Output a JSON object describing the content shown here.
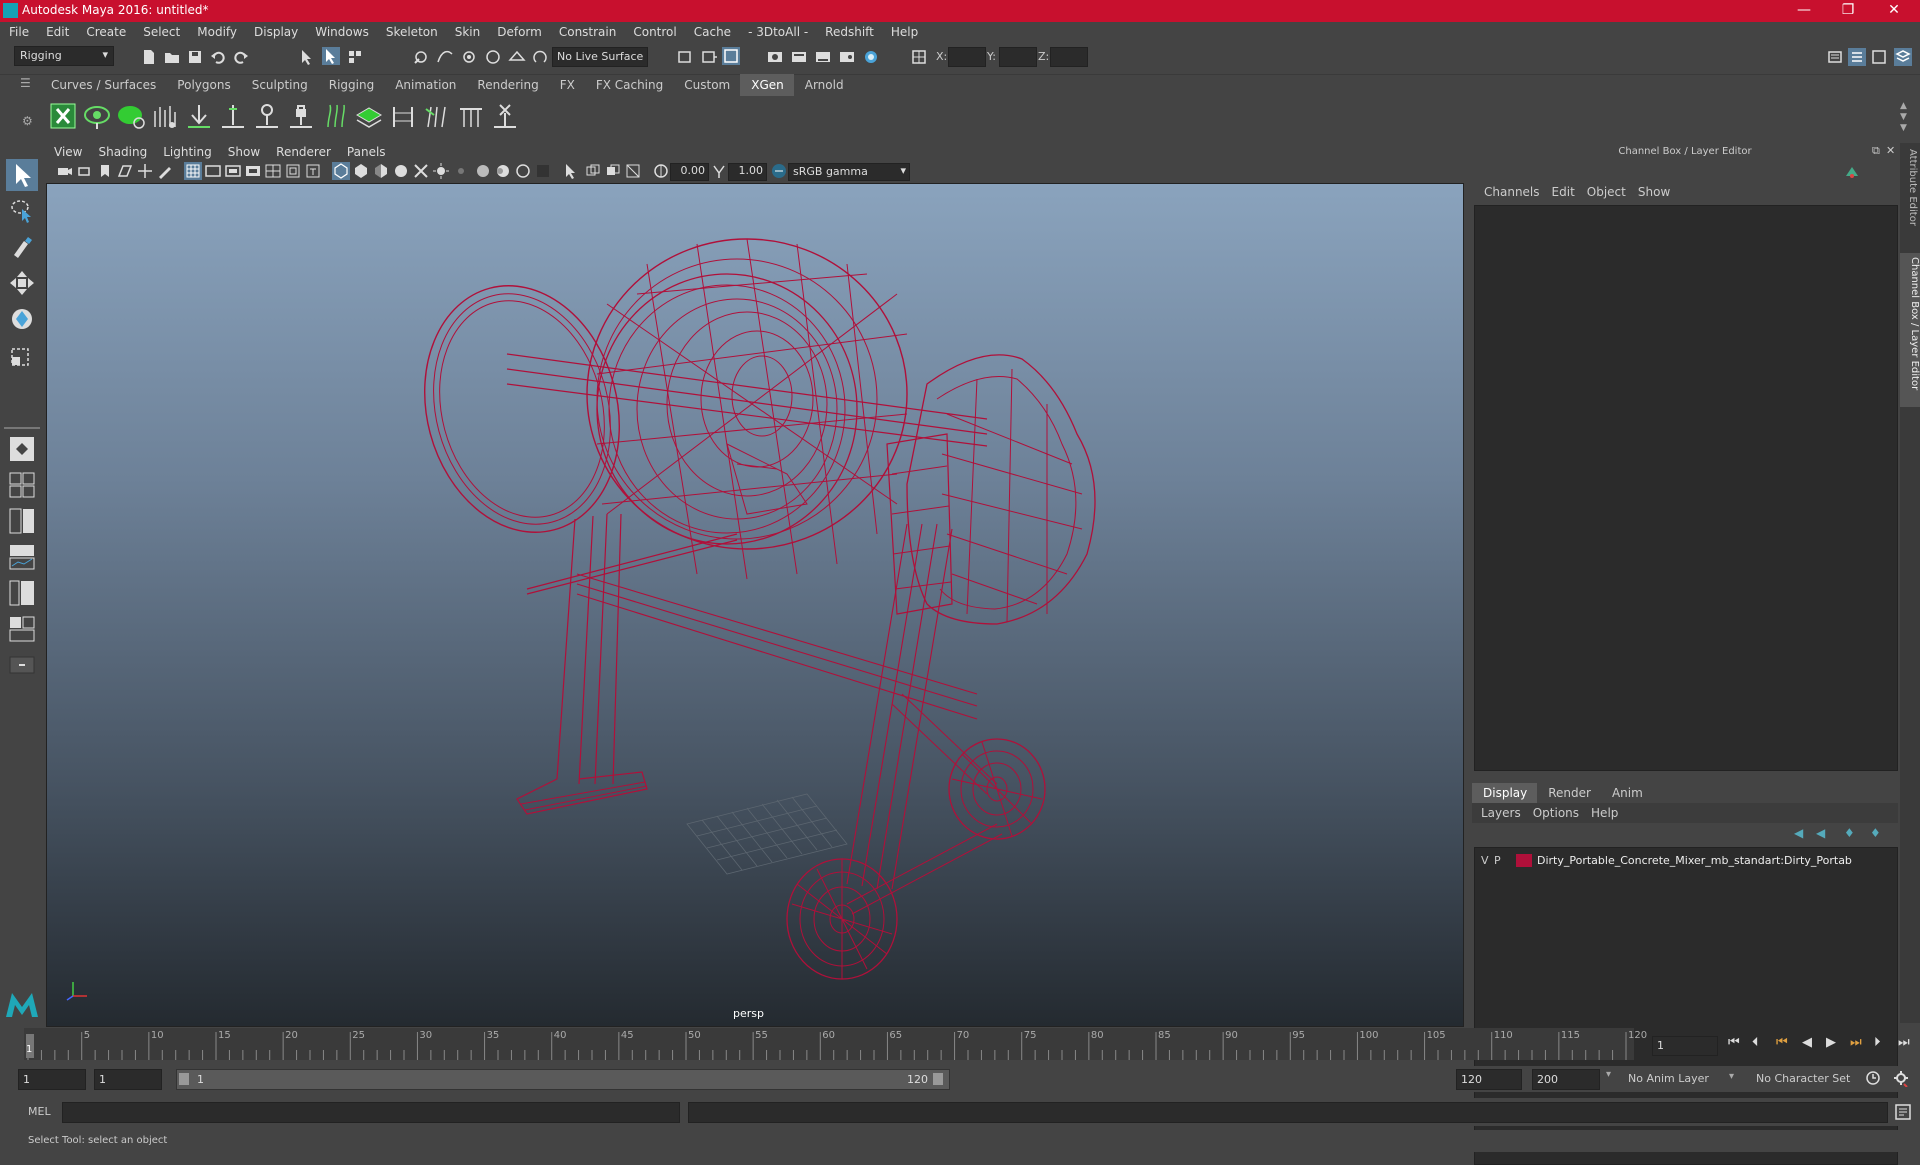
{
  "window": {
    "title": "Autodesk Maya 2016: untitled*"
  },
  "menu": [
    "File",
    "Edit",
    "Create",
    "Select",
    "Modify",
    "Display",
    "Windows",
    "Skeleton",
    "Skin",
    "Deform",
    "Constrain",
    "Control",
    "Cache",
    "- 3DtoAll -",
    "Redshift",
    "Help"
  ],
  "status": {
    "mode": "Rigging",
    "live_surface": "No Live Surface",
    "x_label": "X:",
    "y_label": "Y:",
    "z_label": "Z:"
  },
  "shelf_tabs": [
    "Curves / Surfaces",
    "Polygons",
    "Sculpting",
    "Rigging",
    "Animation",
    "Rendering",
    "FX",
    "FX Caching",
    "Custom",
    "XGen",
    "Arnold"
  ],
  "shelf_active": "XGen",
  "panel_menu": [
    "View",
    "Shading",
    "Lighting",
    "Show",
    "Renderer",
    "Panels"
  ],
  "panel_tools": {
    "exposure": "0.00",
    "gamma": "1.00",
    "color_space": "sRGB gamma"
  },
  "viewport": {
    "camera": "persp",
    "wire_color": "#b0103a"
  },
  "channel_box": {
    "title": "Channel Box / Layer Editor",
    "menu": [
      "Channels",
      "Edit",
      "Object",
      "Show"
    ],
    "layer_tabs": [
      "Display",
      "Render",
      "Anim"
    ],
    "layer_menu": [
      "Layers",
      "Options",
      "Help"
    ],
    "layer": {
      "v": "V",
      "p": "P",
      "name": "Dirty_Portable_Concrete_Mixer_mb_standart:Dirty_Portab",
      "color": "#b0103a"
    }
  },
  "side_tabs": {
    "attribute_editor": "Attribute Editor",
    "channel_box": "Channel Box / Layer Editor"
  },
  "timeline": {
    "ticks": [
      "5",
      "10",
      "15",
      "20",
      "25",
      "30",
      "35",
      "40",
      "45",
      "50",
      "55",
      "60",
      "65",
      "70",
      "75",
      "80",
      "85",
      "90",
      "95",
      "100",
      "105",
      "110",
      "115",
      "120"
    ],
    "current_label": "1",
    "current_frame": "1"
  },
  "range": {
    "start": "1",
    "start_inner": "1",
    "slider_start": "1",
    "slider_end": "120",
    "end_inner": "120",
    "end": "200",
    "anim_layer": "No Anim Layer",
    "char_set": "No Character Set"
  },
  "command": {
    "lang": "MEL"
  },
  "help": {
    "text": "Select Tool: select an object"
  }
}
